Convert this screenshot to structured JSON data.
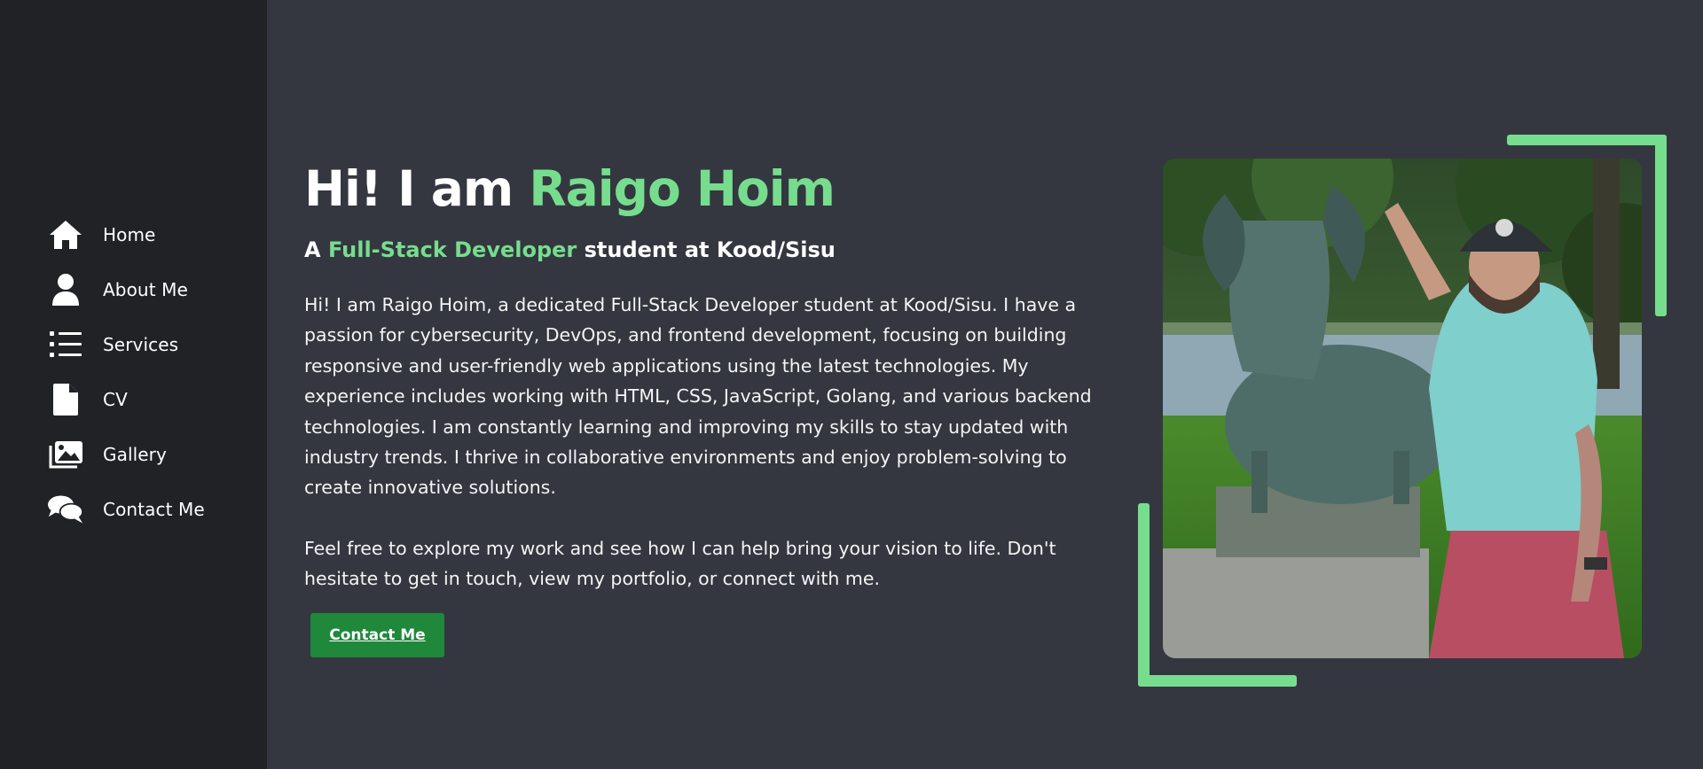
{
  "sidebar": {
    "items": [
      {
        "label": "Home",
        "icon": "home-icon"
      },
      {
        "label": "About Me",
        "icon": "user-icon"
      },
      {
        "label": "Services",
        "icon": "list-icon"
      },
      {
        "label": "CV",
        "icon": "file-icon"
      },
      {
        "label": "Gallery",
        "icon": "images-icon"
      },
      {
        "label": "Contact Me",
        "icon": "chat-icon"
      }
    ]
  },
  "hero": {
    "title_prefix": "Hi! I am ",
    "title_name": "Raigo Hoim",
    "subtitle_prefix": "A ",
    "subtitle_role": "Full-Stack Developer",
    "subtitle_suffix": " student at Kood/Sisu",
    "bio_paragraph_1": "Hi! I am Raigo Hoim, a dedicated Full-Stack Developer student at Kood/Sisu. I have a passion for cybersecurity, DevOps, and frontend development, focusing on building responsive and user-friendly web applications using the latest technologies. My experience includes working with HTML, CSS, JavaScript, Golang, and various backend technologies. I am constantly learning and improving my skills to stay updated with industry trends. I thrive in collaborative environments and enjoy problem-solving to create innovative solutions.",
    "bio_paragraph_2": "Feel free to explore my work and see how I can help bring your vision to life. Don't hesitate to get in touch, view my portfolio, or connect with me.",
    "cta_label": "Contact Me"
  },
  "colors": {
    "background": "#343740",
    "sidebar": "#202226",
    "accent": "#77dd8e",
    "button": "#1f883b"
  }
}
